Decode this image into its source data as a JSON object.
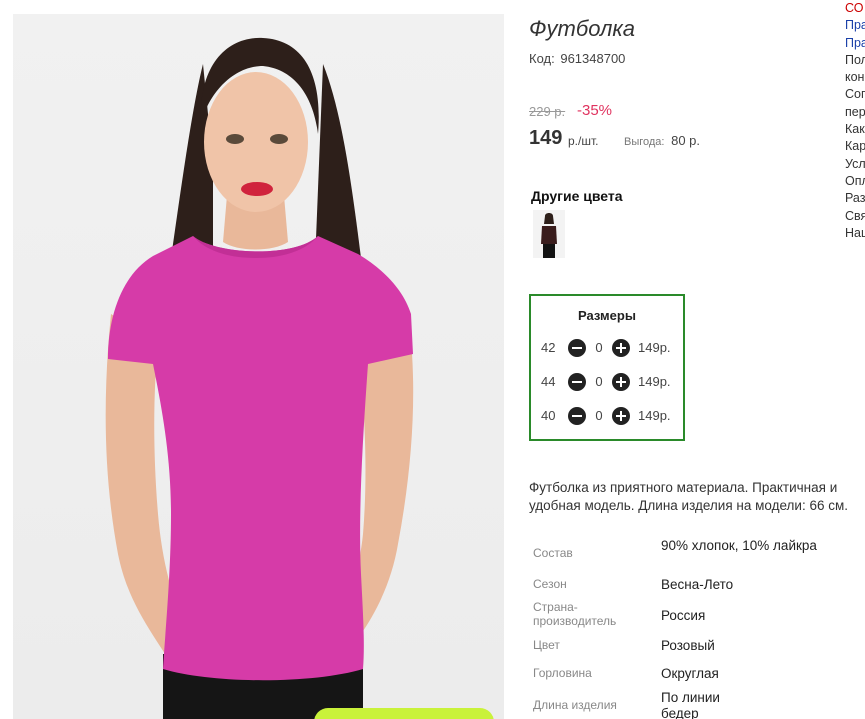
{
  "product": {
    "title": "Футболка",
    "code_label": "Код:",
    "code_value": "961348700",
    "old_price": "229 р.",
    "discount": "-35%",
    "price": "149",
    "price_unit": "р./шт.",
    "profit_label": "Выгода:",
    "profit_value": "80 р."
  },
  "other_colors": {
    "label": "Другие цвета"
  },
  "sizes": {
    "title": "Размеры",
    "rows": [
      {
        "size": "42",
        "qty": "0",
        "price": "149р."
      },
      {
        "size": "44",
        "qty": "0",
        "price": "149р."
      },
      {
        "size": "40",
        "qty": "0",
        "price": "149р."
      }
    ]
  },
  "description": "Футболка из приятного материала. Практичная и удобная модель. Длина изделия на модели: 66 см.",
  "specs": [
    {
      "key": "Состав",
      "value": "90% хлопок, 10% лайкра"
    },
    {
      "key": "Сезон",
      "value": "Весна-Лето"
    },
    {
      "key": "Страна-производитель",
      "value": "Россия"
    },
    {
      "key": "Цвет",
      "value": "Розовый"
    },
    {
      "key": "Горловина",
      "value": "Округлая"
    },
    {
      "key": "Длина изделия",
      "value": "По линии бедер"
    }
  ],
  "side_nav": {
    "items": [
      "СО",
      "Пра",
      "Пра",
      "Пол",
      "кон",
      "Сог",
      "пер",
      "Как",
      "Кар",
      "Усл",
      "Опл",
      "Раз",
      "Свя",
      "Наш"
    ]
  },
  "colors": {
    "accent_green": "#2a8a2a",
    "discount_red": "#e0335f",
    "shirt_pink": "#d63ba8",
    "button_lime": "#c9f23a"
  }
}
